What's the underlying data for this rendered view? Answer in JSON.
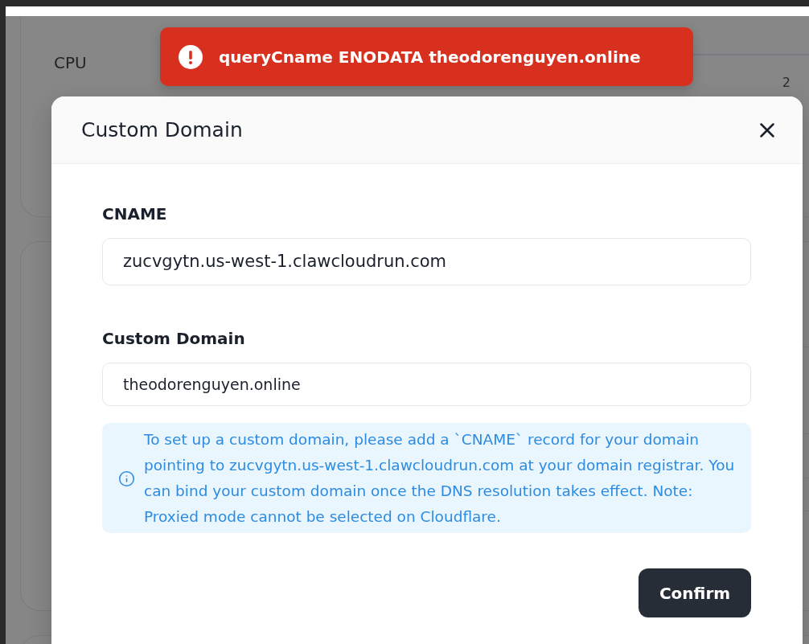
{
  "page": {
    "cpu_card": {
      "title": "CPU",
      "tick_label": "2"
    }
  },
  "toast": {
    "kind": "error",
    "message": "queryCname ENODATA theodorenguyen.online"
  },
  "dialog": {
    "title": "Custom Domain",
    "fields": [
      {
        "label": "CNAME",
        "value": "zucvgytn.us-west-1.clawcloudrun.com",
        "readonly": true
      },
      {
        "label": "Custom Domain",
        "value": "theodorenguyen.online",
        "readonly": false
      }
    ],
    "notice": {
      "kind": "info",
      "text": "To set up a custom domain, please add a `CNAME` record for your domain pointing to zucvgytn.us-west-1.clawcloudrun.com at your domain registrar. You can bind your custom domain once the DNS resolution takes effect. Note: Proxied mode cannot be selected on Cloudflare."
    },
    "buttons": [
      {
        "label": "Confirm",
        "kind": "primary"
      }
    ]
  }
}
